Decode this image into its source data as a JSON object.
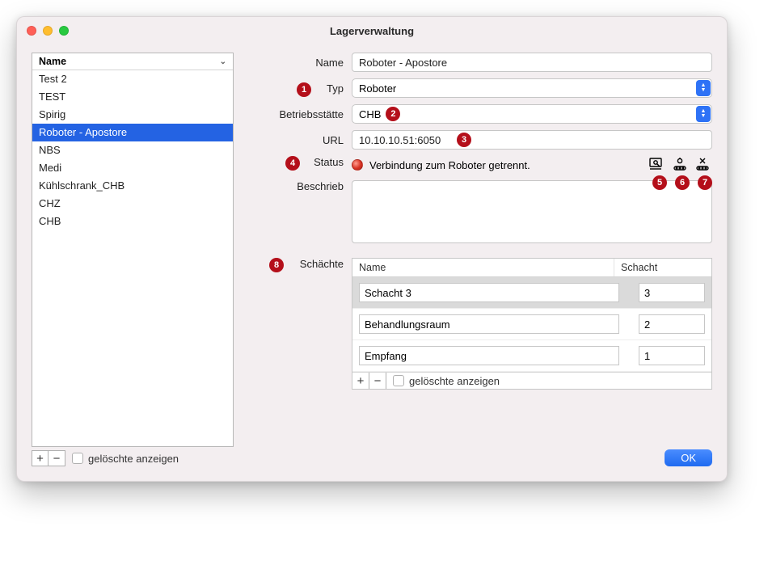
{
  "window": {
    "title": "Lagerverwaltung"
  },
  "sidebar": {
    "header": "Name",
    "items": [
      "Test 2",
      "TEST",
      "Spirig",
      "Roboter - Apostore",
      "NBS",
      "Medi",
      "Kühlschrank_CHB",
      "CHZ",
      "CHB"
    ],
    "selected_index": 3,
    "show_deleted_label": "gelöschte anzeigen"
  },
  "form": {
    "name_label": "Name",
    "name_value": "Roboter - Apostore",
    "typ_label": "Typ",
    "typ_value": "Roboter",
    "betrieb_label": "Betriebsstätte",
    "betrieb_value": "CHB",
    "url_label": "URL",
    "url_value": "10.10.10.51:6050",
    "status_label": "Status",
    "status_value": "Verbindung zum Roboter getrennt.",
    "beschrieb_label": "Beschrieb",
    "beschrieb_value": ""
  },
  "schachte": {
    "label": "Schächte",
    "col_name": "Name",
    "col_schacht": "Schacht",
    "rows": [
      {
        "name": "Schacht 3",
        "schacht": "3"
      },
      {
        "name": "Behandlungsraum",
        "schacht": "2"
      },
      {
        "name": "Empfang",
        "schacht": "1"
      }
    ],
    "selected_index": 0,
    "show_deleted_label": "gelöschte anzeigen"
  },
  "buttons": {
    "ok": "OK"
  },
  "annotations": {
    "b1": "1",
    "b2": "2",
    "b3": "3",
    "b4": "4",
    "b5": "5",
    "b6": "6",
    "b7": "7",
    "b8": "8"
  }
}
